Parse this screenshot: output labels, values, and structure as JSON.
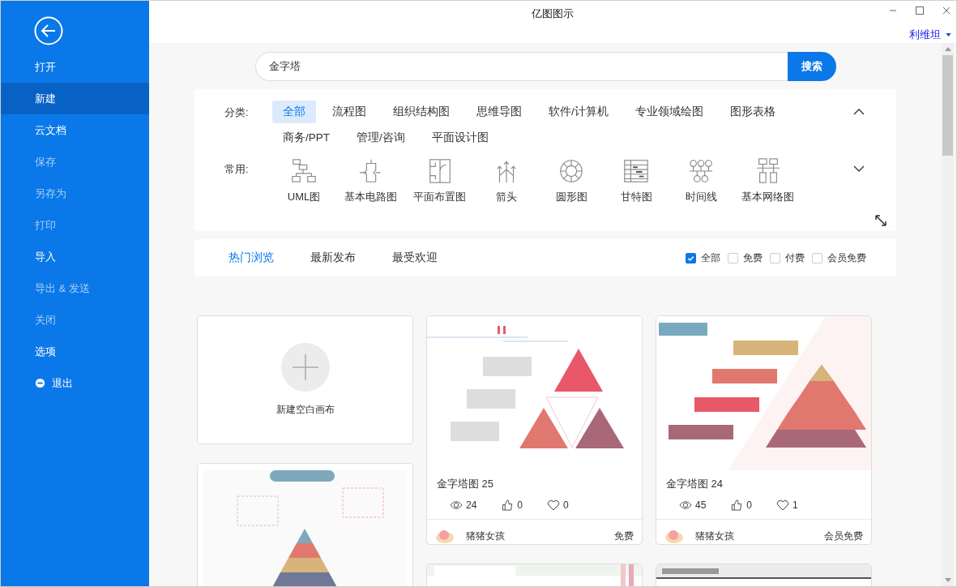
{
  "window": {
    "title": "亿图图示",
    "user": "利维坦"
  },
  "sidebar": {
    "items": [
      {
        "label": "打开",
        "kind": "plain",
        "selected": false,
        "disabled": false
      },
      {
        "label": "新建",
        "kind": "plain",
        "selected": true,
        "disabled": false
      },
      {
        "label": "云文档",
        "kind": "plain",
        "selected": false,
        "disabled": false
      },
      {
        "label": "保存",
        "kind": "plain",
        "selected": false,
        "disabled": true
      },
      {
        "label": "另存为",
        "kind": "plain",
        "selected": false,
        "disabled": true
      },
      {
        "label": "打印",
        "kind": "plain",
        "selected": false,
        "disabled": true
      },
      {
        "label": "导入",
        "kind": "plain",
        "selected": false,
        "disabled": false
      },
      {
        "label": "导出 & 发送",
        "kind": "plain",
        "selected": false,
        "disabled": true
      },
      {
        "label": "关闭",
        "kind": "plain",
        "selected": false,
        "disabled": true
      },
      {
        "label": "选项",
        "kind": "plain",
        "selected": false,
        "disabled": false
      },
      {
        "label": "退出",
        "kind": "exit",
        "selected": false,
        "disabled": false
      }
    ]
  },
  "search": {
    "value": "金字塔",
    "button": "搜索"
  },
  "categories": {
    "label": "分类:",
    "rows": [
      [
        {
          "label": "全部",
          "selected": true
        },
        {
          "label": "流程图",
          "selected": false
        },
        {
          "label": "组织结构图",
          "selected": false
        },
        {
          "label": "思维导图",
          "selected": false
        },
        {
          "label": "软件/计算机",
          "selected": false
        },
        {
          "label": "专业领域绘图",
          "selected": false
        },
        {
          "label": "图形表格",
          "selected": false
        }
      ],
      [
        {
          "label": "商务/PPT",
          "selected": false
        },
        {
          "label": "管理/咨询",
          "selected": false
        },
        {
          "label": "平面设计图",
          "selected": false
        }
      ]
    ]
  },
  "common": {
    "label": "常用:",
    "items": [
      {
        "label": "UML图",
        "kind": "uml"
      },
      {
        "label": "基本电路图",
        "kind": "circuit"
      },
      {
        "label": "平面布置图",
        "kind": "floorplan"
      },
      {
        "label": "箭头",
        "kind": "arrows"
      },
      {
        "label": "圆形图",
        "kind": "circle"
      },
      {
        "label": "甘特图",
        "kind": "gantt"
      },
      {
        "label": "时间线",
        "kind": "timeline"
      },
      {
        "label": "基本网络图",
        "kind": "network"
      }
    ]
  },
  "sort_tabs": [
    {
      "label": "热门浏览",
      "selected": true
    },
    {
      "label": "最新发布",
      "selected": false
    },
    {
      "label": "最受欢迎",
      "selected": false
    }
  ],
  "filters": [
    {
      "label": "全部",
      "checked": true
    },
    {
      "label": "免费",
      "checked": false
    },
    {
      "label": "付费",
      "checked": false
    },
    {
      "label": "会员免费",
      "checked": false
    }
  ],
  "template_columns": [
    [
      {
        "kind": "blank",
        "label": "新建空白画布"
      },
      {
        "kind": "picture"
      }
    ],
    [
      {
        "kind": "template",
        "title": "金字塔图 25",
        "views": "24",
        "likes": "0",
        "favorites": "0",
        "author": "猪猪女孩",
        "price": "免费"
      },
      {
        "kind": "picture"
      }
    ],
    [
      {
        "kind": "template",
        "title": "金字塔图 24",
        "views": "45",
        "likes": "0",
        "favorites": "1",
        "author": "猪猪女孩",
        "price": "会员免费"
      },
      {
        "kind": "picture"
      }
    ]
  ]
}
